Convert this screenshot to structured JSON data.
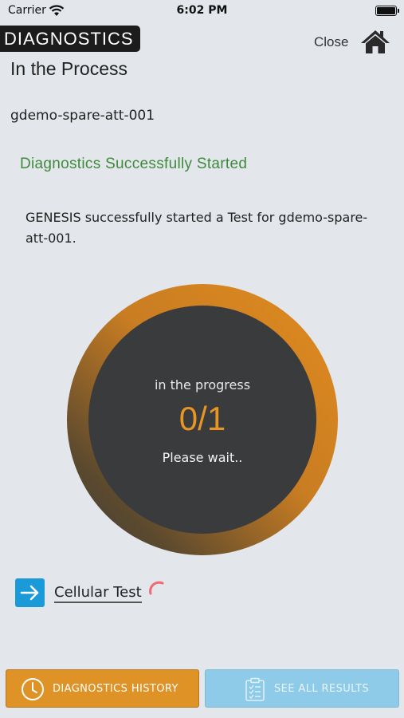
{
  "status_bar": {
    "carrier": "Carrier",
    "time": "6:02 PM"
  },
  "header": {
    "brand": "DIAGNOSTICS",
    "close_label": "Close"
  },
  "page": {
    "title": "In the Process",
    "device_id": "gdemo-spare-att-001",
    "success_title": "Diagnostics Successfully Started",
    "message": "GENESIS successfully started a Test for gdemo-spare-att-001."
  },
  "progress": {
    "caption": "in the progress",
    "count": "0/1",
    "completed": 0,
    "total": 1,
    "wait_text": "Please wait..",
    "accent_color": "#e79524",
    "circle_color": "#3a3b3d"
  },
  "tests": [
    {
      "name": "Cellular Test",
      "icon": "arrow-right-icon",
      "state": "running"
    }
  ],
  "buttons": {
    "history": {
      "label": "DIAGNOSTICS HISTORY",
      "icon": "clock-icon",
      "color": "#df9226"
    },
    "results": {
      "label": "SEE ALL RESULTS",
      "icon": "clipboard-icon",
      "color": "#8ecbe8"
    }
  }
}
